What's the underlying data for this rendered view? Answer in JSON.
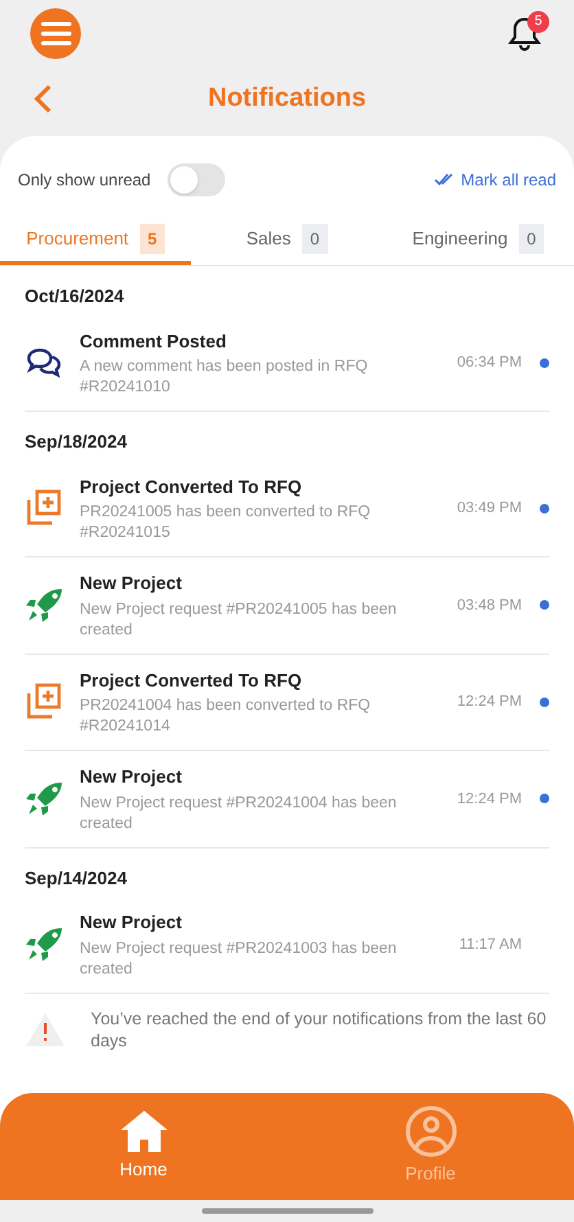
{
  "header": {
    "title": "Notifications",
    "bell_count": "5"
  },
  "filter": {
    "label": "Only show unread",
    "on": false,
    "mark_all": "Mark all read"
  },
  "tabs": [
    {
      "label": "Procurement",
      "count": "5",
      "selected": true
    },
    {
      "label": "Sales",
      "count": "0",
      "selected": false
    },
    {
      "label": "Engineering",
      "count": "0",
      "selected": false
    }
  ],
  "groups": [
    {
      "date": "Oct/16/2024",
      "items": [
        {
          "kind": "comment",
          "title": "Comment Posted",
          "text": "A new comment has been posted in RFQ #R20241010",
          "time": "06:34 PM",
          "unread": true
        }
      ]
    },
    {
      "date": "Sep/18/2024",
      "items": [
        {
          "kind": "convert",
          "title": "Project Converted To RFQ",
          "text": "PR20241005 has been converted to RFQ #R20241015",
          "time": "03:49 PM",
          "unread": true
        },
        {
          "kind": "project",
          "title": "New Project",
          "text": "New Project request #PR20241005 has been created",
          "time": "03:48 PM",
          "unread": true
        },
        {
          "kind": "convert",
          "title": "Project Converted To RFQ",
          "text": "PR20241004 has been converted to RFQ #R20241014",
          "time": "12:24 PM",
          "unread": true
        },
        {
          "kind": "project",
          "title": "New Project",
          "text": "New Project request #PR20241004 has been created",
          "time": "12:24 PM",
          "unread": true
        }
      ]
    },
    {
      "date": "Sep/14/2024",
      "items": [
        {
          "kind": "project",
          "title": "New Project",
          "text": "New Project request #PR20241003 has been created",
          "time": "11:17 AM",
          "unread": false
        }
      ]
    }
  ],
  "end_message": "You’ve reached the end of your notifications from the last 60 days",
  "nav": [
    {
      "kind": "home",
      "label": "Home",
      "selected": true
    },
    {
      "kind": "profile",
      "label": "Profile",
      "selected": false
    }
  ]
}
